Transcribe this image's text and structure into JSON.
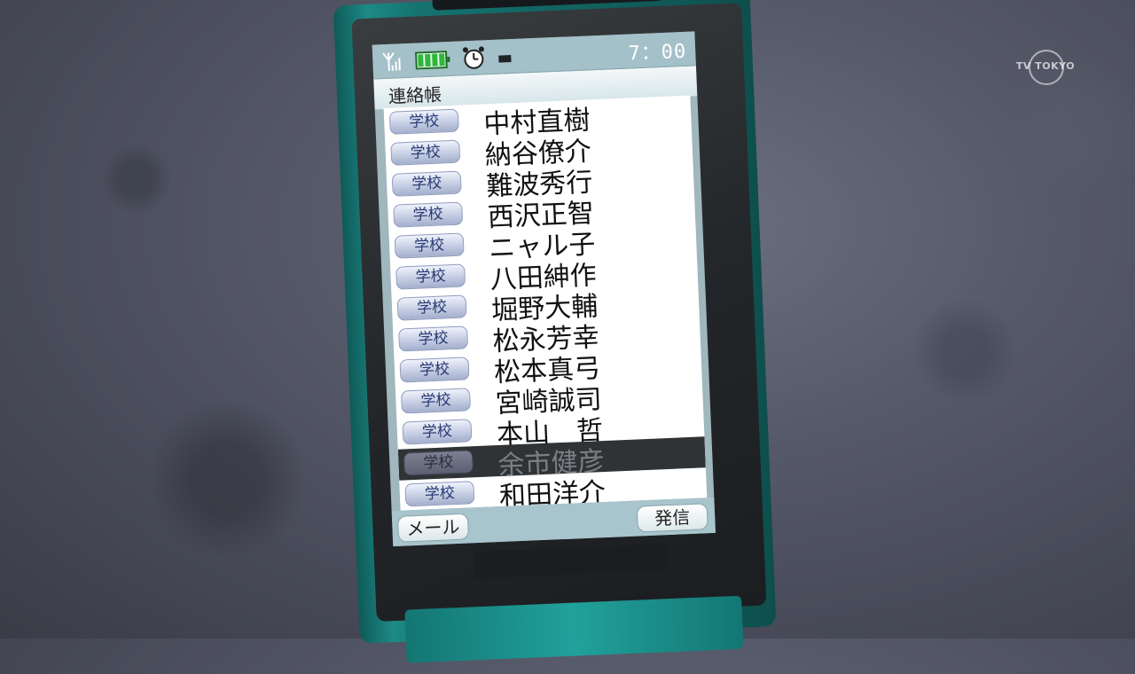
{
  "watermark": "TV TOKYO",
  "status": {
    "time": "7：00",
    "icons": [
      "signal-icon",
      "battery-icon",
      "alarm-icon",
      "mode-icon"
    ]
  },
  "screen_title": "連絡帳",
  "contacts": [
    {
      "group": "学校",
      "name": "中村直樹"
    },
    {
      "group": "学校",
      "name": "納谷僚介"
    },
    {
      "group": "学校",
      "name": "難波秀行"
    },
    {
      "group": "学校",
      "name": "西沢正智"
    },
    {
      "group": "学校",
      "name": "ニャル子"
    },
    {
      "group": "学校",
      "name": "八田紳作"
    },
    {
      "group": "学校",
      "name": "堀野大輔"
    },
    {
      "group": "学校",
      "name": "松永芳幸"
    },
    {
      "group": "学校",
      "name": "松本真弓"
    },
    {
      "group": "学校",
      "name": "宮崎誠司"
    },
    {
      "group": "学校",
      "name": "本山　哲"
    },
    {
      "group": "学校",
      "name": "余市健彦",
      "selected": true
    },
    {
      "group": "学校",
      "name": "和田洋介"
    }
  ],
  "softkeys": {
    "left": "メール",
    "right": "発信"
  },
  "colors": {
    "phone_body": "#1d8a86",
    "status_bar": "#a4c0c8",
    "group_tag": "#c5cde3",
    "selected_row": "#2f3336"
  }
}
